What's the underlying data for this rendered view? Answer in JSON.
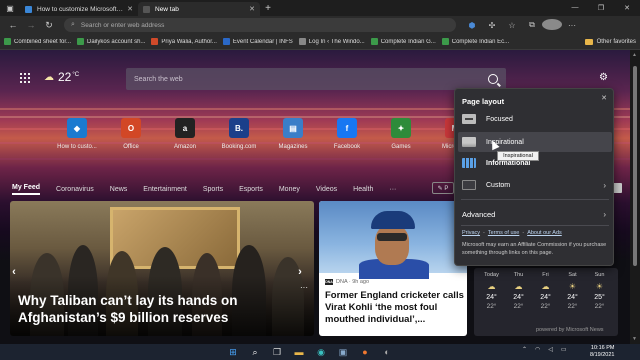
{
  "tabs": [
    {
      "label": "How to customize Microsoft Edge",
      "favicon_color": "#3a86d6"
    },
    {
      "label": "New tab",
      "favicon_color": "#555555"
    }
  ],
  "address_bar": {
    "placeholder": "Search or enter web address"
  },
  "bookmarks": [
    {
      "label": "Combined sheet for...",
      "icon_color": "#3c9a4a"
    },
    {
      "label": "Dailykos account sh...",
      "icon_color": "#3c9a4a"
    },
    {
      "label": "Priya Walia, Author...",
      "icon_color": "#d04a2a"
    },
    {
      "label": "Event Calendar | INFS",
      "icon_color": "#2a68c8"
    },
    {
      "label": "Log In ‹ The Windo...",
      "icon_color": "#888888"
    },
    {
      "label": "Complete Indian G...",
      "icon_color": "#3c9a4a"
    },
    {
      "label": "Complete Indian Ec...",
      "icon_color": "#3c9a4a"
    }
  ],
  "other_favorites": "Other favorites",
  "weather": {
    "temp": "22",
    "unit": "°C"
  },
  "search": {
    "placeholder": "Search the web"
  },
  "quick_links": [
    {
      "label": "How to custo...",
      "glyph": "◆",
      "color": "#1a7ad0"
    },
    {
      "label": "Office",
      "glyph": "O",
      "color": "#d24726"
    },
    {
      "label": "Amazon",
      "glyph": "a",
      "color": "#222222"
    },
    {
      "label": "Booking.com",
      "glyph": "B.",
      "color": "#1b3f8a"
    },
    {
      "label": "Magazines",
      "glyph": "▤",
      "color": "#3a7ec8"
    },
    {
      "label": "Facebook",
      "glyph": "f",
      "color": "#1877f2"
    },
    {
      "label": "Games",
      "glyph": "✦",
      "color": "#2e8b3a"
    },
    {
      "label": "Microso...",
      "glyph": "M",
      "color": "#c8373a"
    }
  ],
  "feed_nav": {
    "active": "My Feed",
    "items": [
      "Coronavirus",
      "News",
      "Entertainment",
      "Sports",
      "Esports",
      "Money",
      "Videos",
      "Health"
    ],
    "more": "···",
    "personalize_icon": "✎ P"
  },
  "main_story": {
    "headline": "Why Taliban can’t lay its hands on Afghanistan’s $9 billion reserves"
  },
  "side_story": {
    "source": "DNA · 9h ago",
    "source_logo": "DNA",
    "headline": "Former England cricketer calls Virat Kohli ‘the most foul mouthed individual’,..."
  },
  "page_layout": {
    "title": "Page layout",
    "options": [
      {
        "label": "Focused",
        "icon": "focused"
      },
      {
        "label": "Inspirational",
        "icon": "insp"
      },
      {
        "label": "Informational",
        "icon": "info"
      },
      {
        "label": "Custom",
        "icon": "cust"
      }
    ],
    "advanced": "Advanced",
    "links": [
      "Privacy",
      "Terms of use",
      "About our Ads"
    ],
    "note": "Microsoft may earn an Affiliate Commission if you purchase something through links on this page.",
    "tooltip": "Inspirational"
  },
  "forecast": [
    {
      "day": "Today",
      "hi": "24°",
      "lo": "22°"
    },
    {
      "day": "Thu",
      "hi": "24°",
      "lo": "22°"
    },
    {
      "day": "Fri",
      "hi": "24°",
      "lo": "22°"
    },
    {
      "day": "Sat",
      "hi": "24°",
      "lo": "22°"
    },
    {
      "day": "Sun",
      "hi": "25°",
      "lo": "22°"
    }
  ],
  "powered_by": "powered by Microsoft News",
  "taskbar": {
    "time": "10:16 PM",
    "date": "8/19/2021"
  }
}
